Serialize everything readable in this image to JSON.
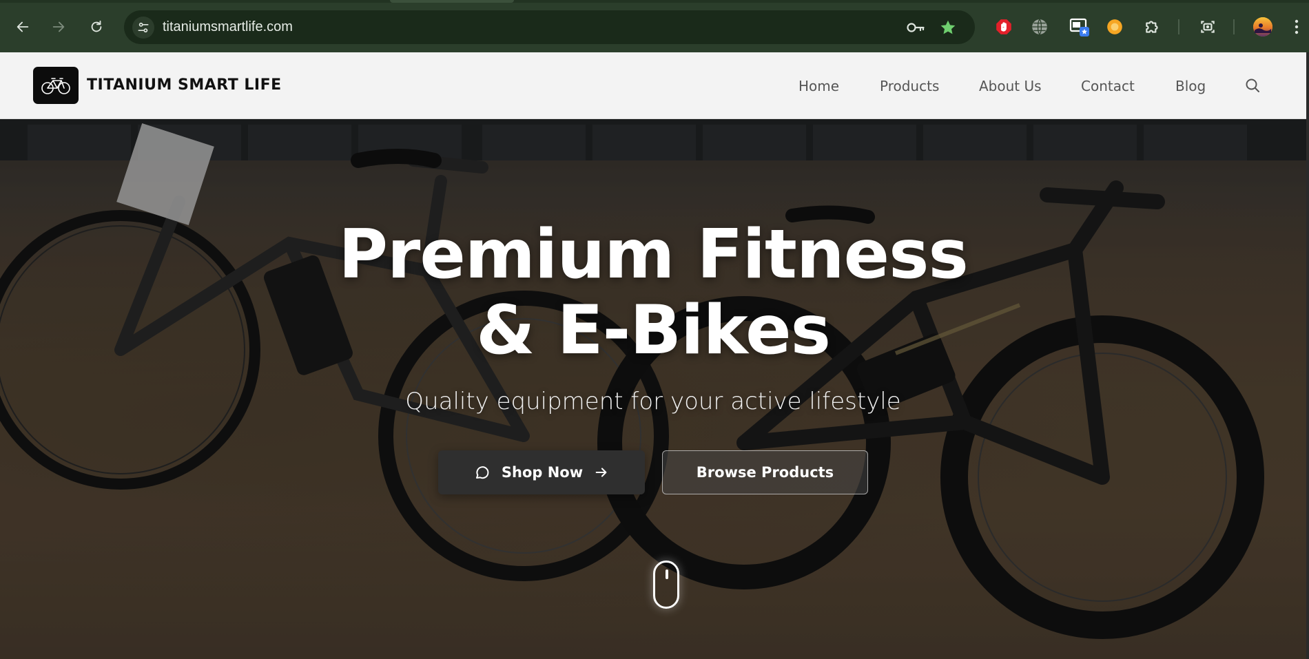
{
  "browser": {
    "url": "titaniumsmartlife.com",
    "icons": [
      "back-icon",
      "forward-icon",
      "reload-icon",
      "site-info-icon",
      "key-icon",
      "bookmark-star-icon"
    ],
    "extensions": [
      "adblock-icon",
      "globe-icon",
      "picture-in-picture-icon",
      "orange-extension-icon",
      "puzzle-icon",
      "screenshot-icon",
      "profile-avatar"
    ]
  },
  "site": {
    "brand": "TITANIUM SMART LIFE",
    "nav": [
      "Home",
      "Products",
      "About Us",
      "Contact",
      "Blog"
    ]
  },
  "hero": {
    "title_line1": "Premium Fitness",
    "title_line2": "& E-Bikes",
    "subtitle": "Quality equipment for your active lifestyle",
    "primary_button": "Shop Now",
    "secondary_button": "Browse Products"
  },
  "colors": {
    "chrome": "#2b3e2b",
    "omnibox": "#1a2a1a",
    "header_bg": "#f3f3f3",
    "button_dark": "#2f2f2f",
    "star_green": "#6fcf6f"
  }
}
